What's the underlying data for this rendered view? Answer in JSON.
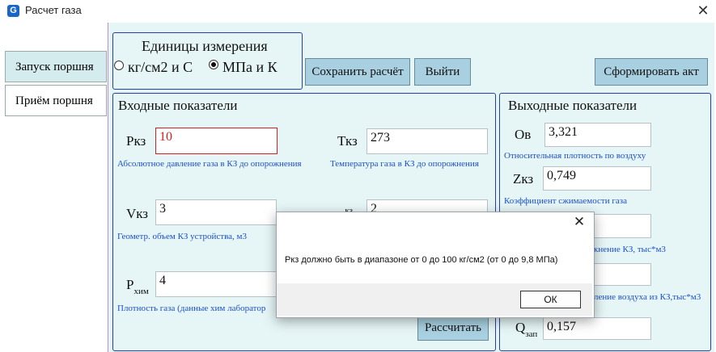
{
  "window": {
    "title": "Расчет газа",
    "app_icon": "gas-icon",
    "close_icon": "close-icon"
  },
  "tabs": [
    {
      "label": "Запуск поршня",
      "active": true
    },
    {
      "label": "Приём поршня",
      "active": false
    }
  ],
  "units": {
    "title": "Единицы измерения",
    "options": [
      {
        "label": "кг/см2 и С",
        "selected": false
      },
      {
        "label": "МПа и К",
        "selected": true
      }
    ]
  },
  "toolbar": {
    "save_label": "Сохранить расчёт",
    "exit_label": "Выйти",
    "act_label": "Сформировать акт"
  },
  "inputs": {
    "title": "Входные показатели",
    "rkz": {
      "label": "Ркз",
      "value": "10",
      "hint": "Абсолютное давление газа в КЗ до опорожнения"
    },
    "tkz": {
      "label": "Ткз",
      "value": "273",
      "hint": "Температура газа в КЗ до опорожнения"
    },
    "vkz": {
      "label": "Vкз",
      "value": "3",
      "hint": "Геометр. объем КЗ устройства,  м3"
    },
    "lkz": {
      "label": "L",
      "sup": "кз",
      "value": "2"
    },
    "rhim": {
      "label": "Р",
      "sub": "хим",
      "value": "4",
      "hint": "Плотность газа (данные хим лаборатор"
    },
    "calc_label": "Рассчитать"
  },
  "outputs": {
    "title": "Выходные показатели",
    "ov": {
      "label": "Ов",
      "value": "3,321",
      "hint": "Относительная плотность по воздуху"
    },
    "zkz": {
      "label": "Zкз",
      "value": "0,749",
      "hint": "Коэффициент сжимаемости газа"
    },
    "hint3": "кнение КЗ, тыс*м3",
    "hint4": "ление воздуха из КЗ,тыс*м3",
    "qzap": {
      "label": "Q",
      "sub": "зап",
      "value": "0,157"
    }
  },
  "dialog": {
    "message": "Ркз должно быть в диапазоне от 0 до 100 кг/см2 (от 0 до 9,8 МПа)",
    "ok_label": "ОК",
    "close_icon": "close-icon"
  }
}
